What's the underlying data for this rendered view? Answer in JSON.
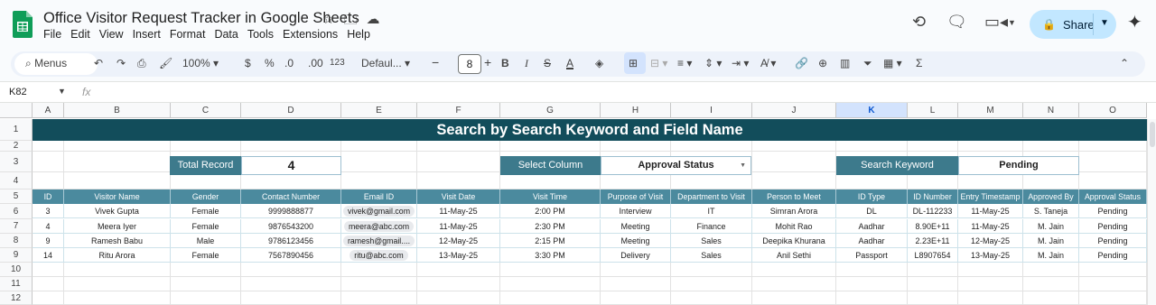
{
  "app": {
    "title": "Office Visitor Request Tracker in Google Sheets",
    "menu": [
      "File",
      "Edit",
      "View",
      "Insert",
      "Format",
      "Data",
      "Tools",
      "Extensions",
      "Help"
    ],
    "share_label": "Share"
  },
  "toolbar": {
    "search_menus": "Menus",
    "zoom": "100%",
    "currency": "$",
    "percent": "%",
    "dec_decrease": ".0",
    "dec_increase": ".00",
    "number_format": "123",
    "font": "Defaul...",
    "font_size": "8",
    "bold": "B",
    "italic": "I"
  },
  "formula_bar": {
    "cell_ref": "K82",
    "fx": "fx"
  },
  "columns": [
    "A",
    "B",
    "C",
    "D",
    "E",
    "F",
    "G",
    "H",
    "I",
    "J",
    "K",
    "L",
    "M",
    "N",
    "O"
  ],
  "selected_column": "K",
  "rows": [
    "1",
    "2",
    "3",
    "4",
    "5",
    "6",
    "7",
    "8",
    "9",
    "10",
    "11",
    "12"
  ],
  "sheet": {
    "banner": "Search by Search Keyword and Field Name",
    "total_record_label": "Total Record",
    "total_record_value": "4",
    "select_column_label": "Select Column",
    "select_column_value": "Approval Status",
    "search_keyword_label": "Search Keyword",
    "search_keyword_value": "Pending",
    "headers": [
      "ID",
      "Visitor Name",
      "Gender",
      "Contact Number",
      "Email ID",
      "Visit Date",
      "Visit Time",
      "Purpose of Visit",
      "Department to Visit",
      "Person to Meet",
      "ID Type",
      "ID Number",
      "Entry Timestamp",
      "Approved By",
      "Approval Status"
    ],
    "records": [
      [
        "3",
        "Vivek Gupta",
        "Female",
        "9999888877",
        "vivek@gmail.com",
        "11-May-25",
        "2:00 PM",
        "Interview",
        "IT",
        "Simran Arora",
        "DL",
        "DL-112233",
        "11-May-25",
        "S. Taneja",
        "Pending"
      ],
      [
        "4",
        "Meera Iyer",
        "Female",
        "9876543200",
        "meera@abc.com",
        "11-May-25",
        "2:30 PM",
        "Meeting",
        "Finance",
        "Mohit Rao",
        "Aadhar",
        "8.90E+11",
        "11-May-25",
        "M. Jain",
        "Pending"
      ],
      [
        "9",
        "Ramesh Babu",
        "Male",
        "9786123456",
        "ramesh@gmail....",
        "12-May-25",
        "2:15 PM",
        "Meeting",
        "Sales",
        "Deepika Khurana",
        "Aadhar",
        "2.23E+11",
        "12-May-25",
        "M. Jain",
        "Pending"
      ],
      [
        "14",
        "Ritu Arora",
        "Female",
        "7567890456",
        "ritu@abc.com",
        "13-May-25",
        "3:30 PM",
        "Delivery",
        "Sales",
        "Anil Sethi",
        "Passport",
        "L8907654",
        "13-May-25",
        "M. Jain",
        "Pending"
      ]
    ]
  },
  "colors": {
    "banner": "#124d5b",
    "label_bg": "#3d7a8c",
    "header_bg": "#4b8a9e",
    "share_bg": "#c2e7ff"
  }
}
